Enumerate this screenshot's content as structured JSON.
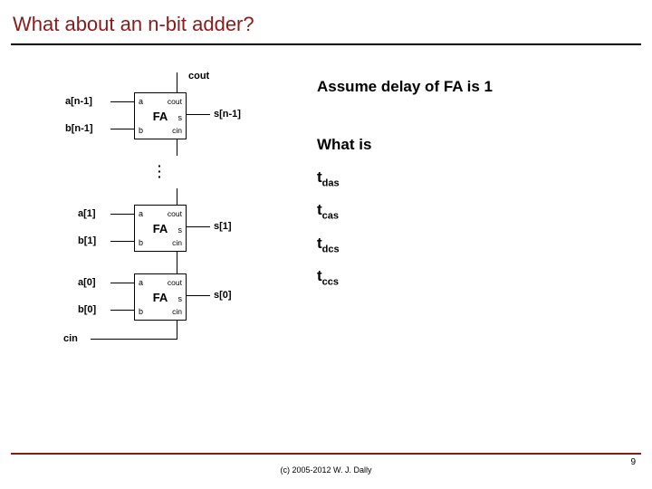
{
  "title": "What about an n-bit adder?",
  "right": {
    "assume": "Assume delay of FA is 1",
    "whatis": "What is",
    "terms": [
      {
        "base": "t",
        "sub": "das"
      },
      {
        "base": "t",
        "sub": "cas"
      },
      {
        "base": "t",
        "sub": "dcs"
      },
      {
        "base": "t",
        "sub": "ccs"
      }
    ]
  },
  "diagram": {
    "fa_label": "FA",
    "ports": {
      "a": "a",
      "b": "b",
      "cout": "cout",
      "s": "s",
      "cin": "cin"
    },
    "signals": {
      "cout_top": "cout",
      "a_top": "a[n-1]",
      "b_top": "b[n-1]",
      "s_top": "s[n-1]",
      "a_mid": "a[1]",
      "b_mid": "b[1]",
      "s_mid": "s[1]",
      "a_bot": "a[0]",
      "b_bot": "b[0]",
      "s_bot": "s[0]",
      "cin_bot": "cin"
    }
  },
  "footer": {
    "copyright": "(c) 2005-2012 W. J. Dally",
    "page": "9"
  }
}
